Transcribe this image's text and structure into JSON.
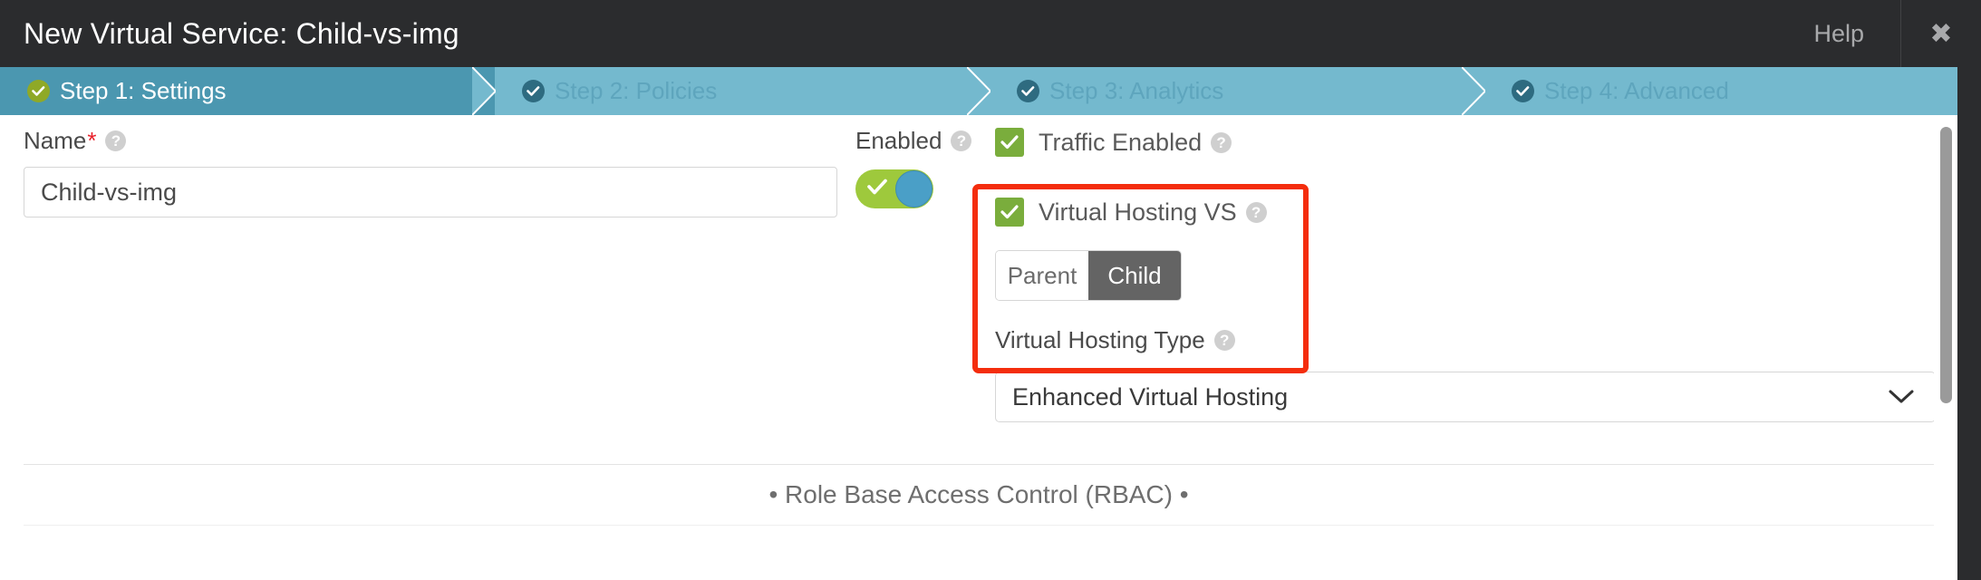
{
  "window": {
    "title": "New Virtual Service: Child-vs-img",
    "help_label": "Help",
    "close_icon": "close-icon"
  },
  "steps": [
    {
      "label": "Step 1: Settings",
      "active": true,
      "check_icon": "check-circle-icon"
    },
    {
      "label": "Step 2: Policies",
      "active": false,
      "check_icon": "check-circle-icon"
    },
    {
      "label": "Step 3: Analytics",
      "active": false,
      "check_icon": "check-circle-icon"
    },
    {
      "label": "Step 4: Advanced",
      "active": false,
      "check_icon": "check-circle-icon"
    }
  ],
  "form": {
    "name": {
      "label": "Name",
      "required_marker": "*",
      "help_icon": "question-mark-icon",
      "value": "Child-vs-img",
      "placeholder": ""
    },
    "enabled": {
      "label": "Enabled",
      "help_icon": "question-mark-icon",
      "toggle_state": "on",
      "toggle_icon": "checkmark-icon"
    },
    "traffic_enabled": {
      "label": "Traffic Enabled",
      "help_icon": "question-mark-icon",
      "checked": true,
      "check_icon": "checkmark-icon"
    },
    "virtual_hosting_vs": {
      "label": "Virtual Hosting VS",
      "help_icon": "question-mark-icon",
      "checked": true,
      "check_icon": "checkmark-icon"
    },
    "vs_type": {
      "options": [
        "Parent",
        "Child"
      ],
      "selected": "Child"
    },
    "virtual_hosting_type": {
      "label": "Virtual Hosting Type",
      "help_icon": "question-mark-icon",
      "selected": "Enhanced Virtual Hosting",
      "chevron_icon": "chevron-down-icon"
    }
  },
  "sections": {
    "rbac": "• Role Base Access Control (RBAC) •"
  },
  "colors": {
    "titlebar_bg": "#2b2c2e",
    "step_active_bg": "#4b97b0",
    "step_inactive_bg": "#74b9ce",
    "step_active_check": "#8fa927",
    "step_inactive_check": "#2e6b80",
    "checkbox_green": "#7aad3c",
    "toggle_green": "#9ec93c",
    "toggle_knob_blue": "#4a9fc7",
    "required_red": "#e8202a",
    "highlight_red": "#f42d0d",
    "segment_selected_bg": "#646464"
  }
}
